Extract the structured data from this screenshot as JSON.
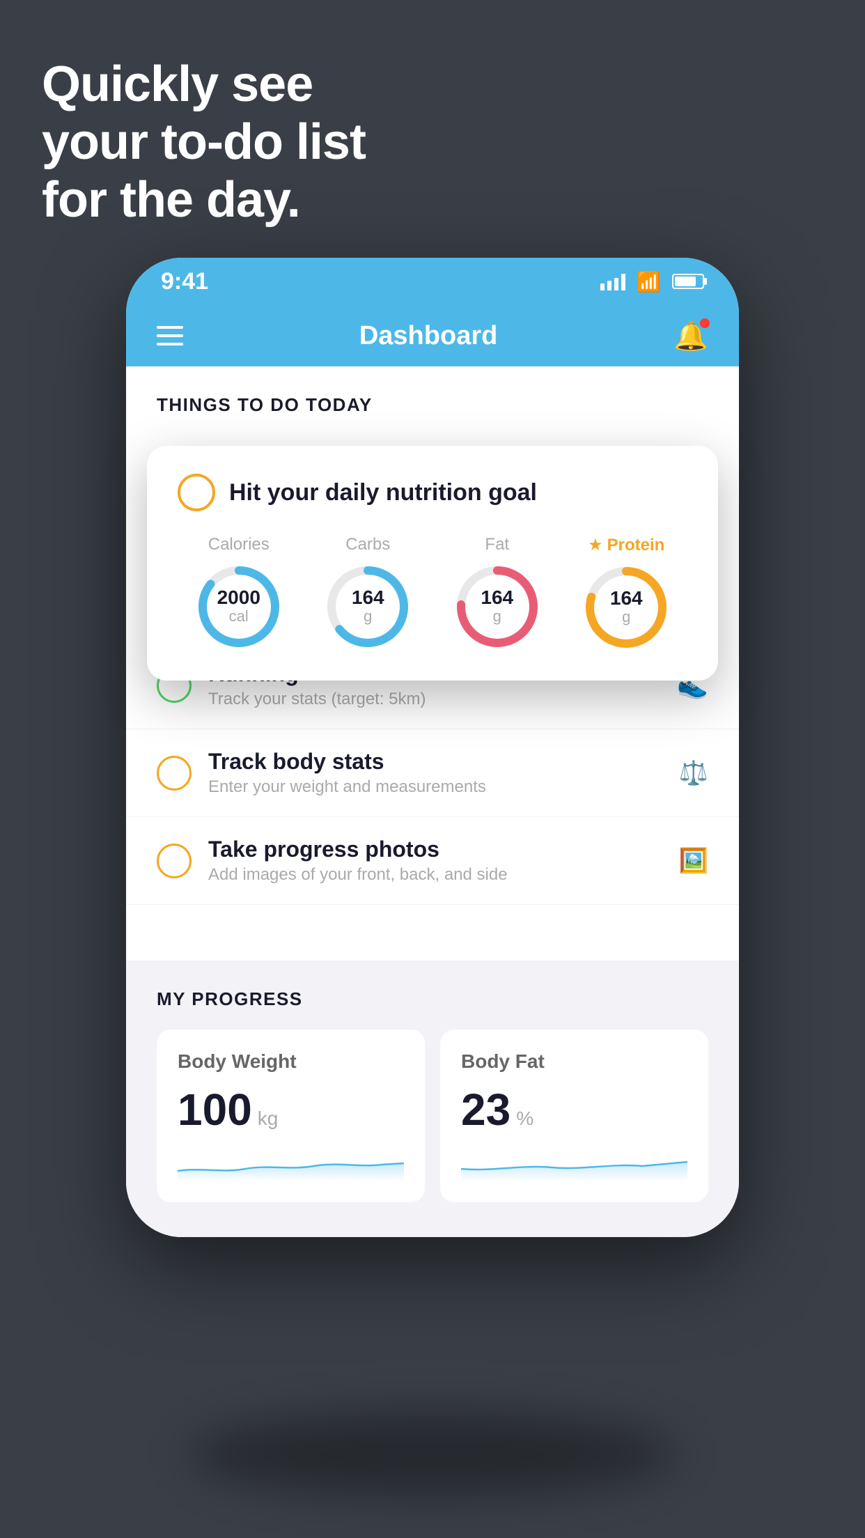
{
  "hero": {
    "line1": "Quickly see",
    "line2": "your to-do list",
    "line3": "for the day."
  },
  "status_bar": {
    "time": "9:41"
  },
  "header": {
    "title": "Dashboard"
  },
  "things_section": {
    "heading": "THINGS TO DO TODAY"
  },
  "nutrition_card": {
    "title": "Hit your daily nutrition goal",
    "stats": [
      {
        "label": "Calories",
        "value": "2000",
        "unit": "cal",
        "color": "blue",
        "highlight": false
      },
      {
        "label": "Carbs",
        "value": "164",
        "unit": "g",
        "color": "blue",
        "highlight": false
      },
      {
        "label": "Fat",
        "value": "164",
        "unit": "g",
        "color": "pink",
        "highlight": false
      },
      {
        "label": "Protein",
        "value": "164",
        "unit": "g",
        "color": "yellow",
        "highlight": true
      }
    ]
  },
  "todo_items": [
    {
      "title": "Running",
      "subtitle": "Track your stats (target: 5km)",
      "circle_color": "green",
      "icon": "shoe"
    },
    {
      "title": "Track body stats",
      "subtitle": "Enter your weight and measurements",
      "circle_color": "yellow",
      "icon": "scale"
    },
    {
      "title": "Take progress photos",
      "subtitle": "Add images of your front, back, and side",
      "circle_color": "yellow",
      "icon": "portrait"
    }
  ],
  "progress_section": {
    "heading": "MY PROGRESS",
    "cards": [
      {
        "title": "Body Weight",
        "value": "100",
        "unit": "kg"
      },
      {
        "title": "Body Fat",
        "value": "23",
        "unit": "%"
      }
    ]
  }
}
